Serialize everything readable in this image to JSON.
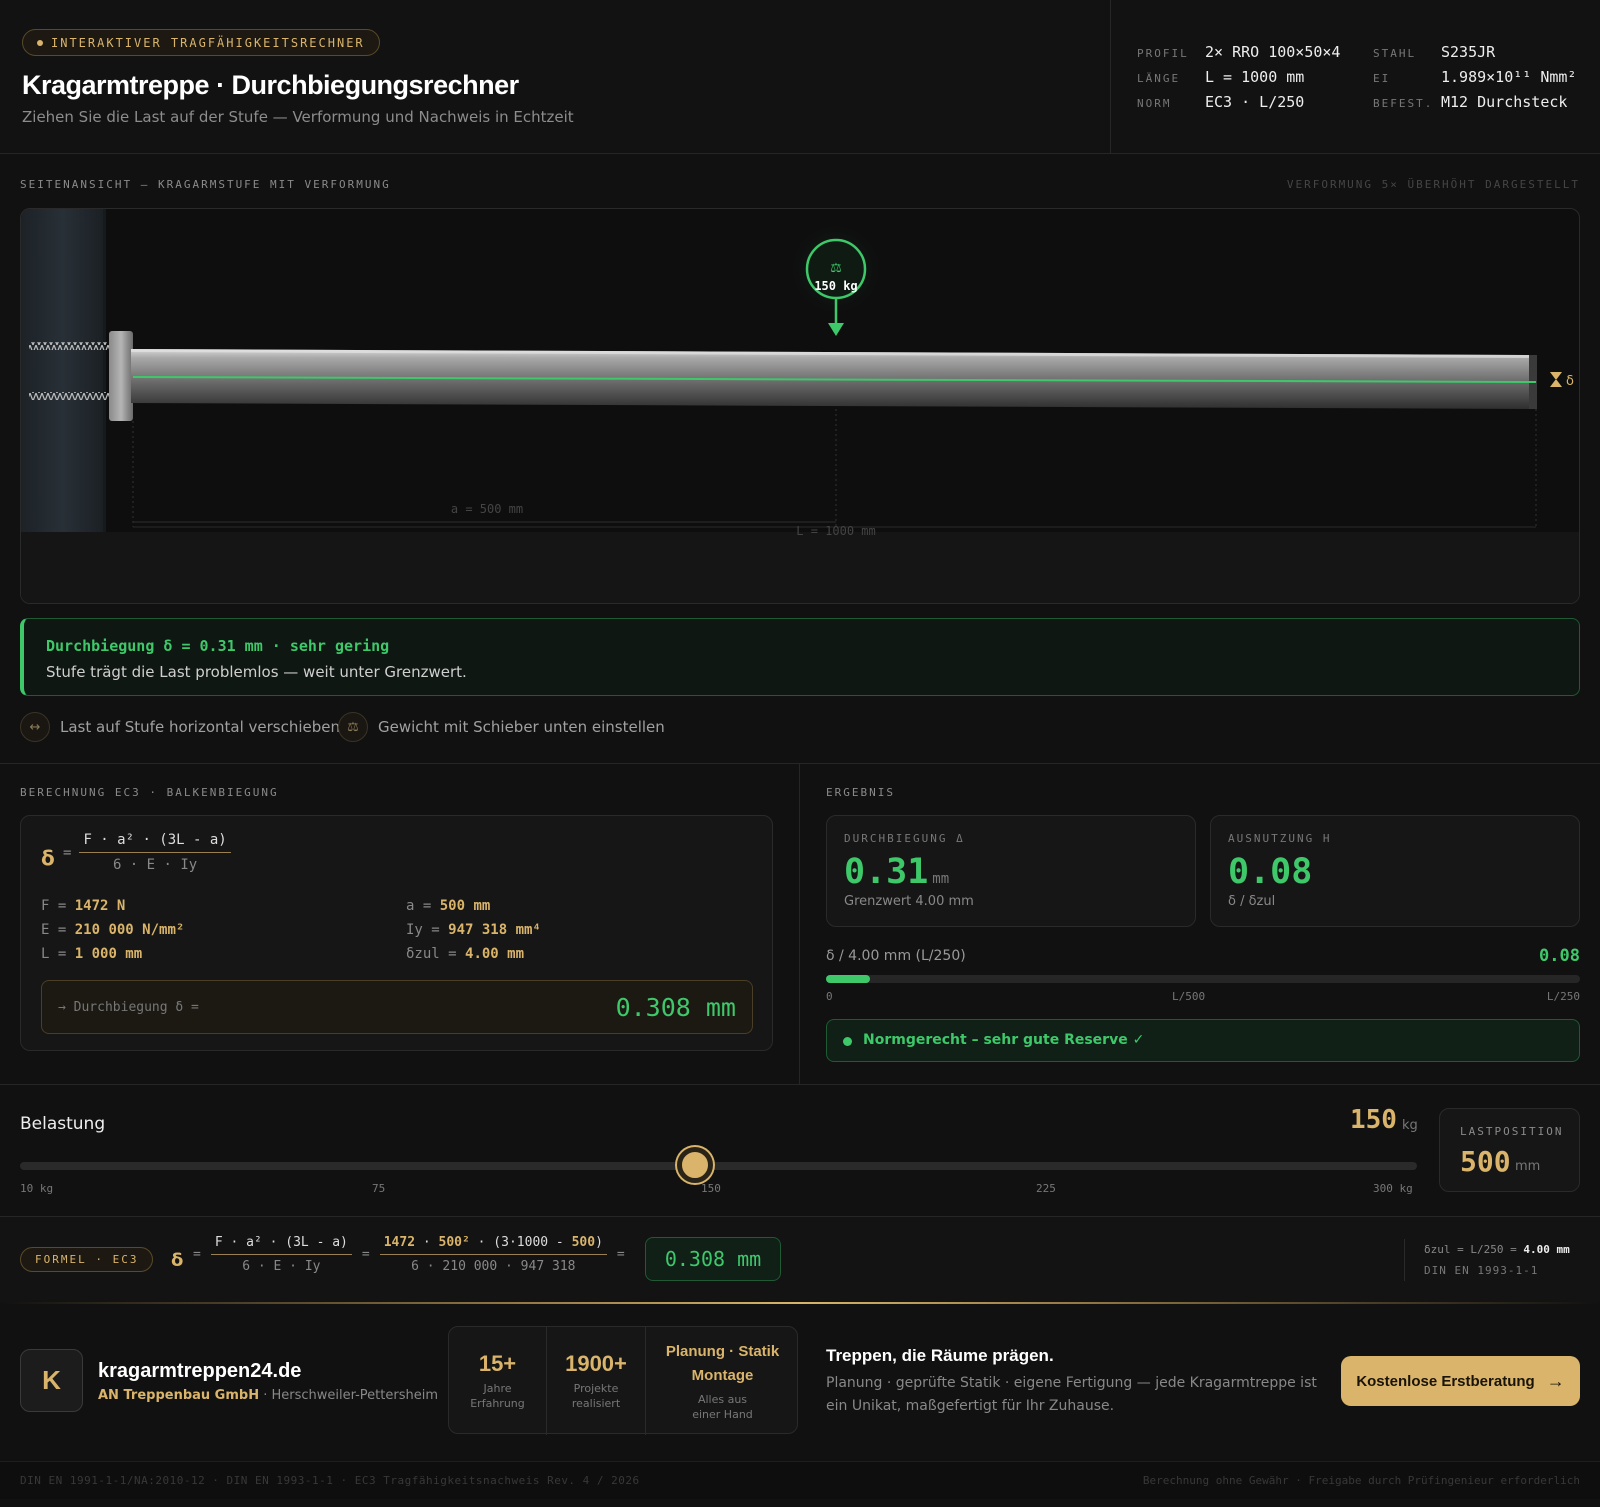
{
  "header": {
    "badge": "INTERAKTIVER TRAGFÄHIGKEITSRECHNER",
    "title": "Kragarmtreppe · Durchbiegungsrechner",
    "subtitle": "Ziehen Sie die Last auf der Stufe — Verformung und Nachweis in Echtzeit",
    "specs": {
      "profil_label": "PROFIL",
      "profil_value": "2× RRO 100×50×4",
      "laenge_label": "LÄNGE",
      "laenge_value": "L = 1000 mm",
      "norm_label": "NORM",
      "norm_value": "EC3 · L/250",
      "stahl_label": "STAHL",
      "stahl_value": "S235JR",
      "ei_label": "EI",
      "ei_value": "1.989×10¹¹ Nmm²",
      "befest_label": "BEFEST.",
      "befest_value": "M12 Durchsteck"
    }
  },
  "side_view": {
    "label": "SEITENANSICHT — KRAGARMSTUFE MIT VERFORMUNG",
    "note": "VERFORMUNG 5× ÜBERHÖHT DARGESTELLT",
    "load_label": "150 kg",
    "dim_a": "a = 500 mm",
    "dim_L": "L = 1000 mm",
    "delta_marker": "δ",
    "load_position_fraction": 0.5
  },
  "status": {
    "line1": "Durchbiegung δ = 0.31 mm · sehr gering",
    "line2": "Stufe trägt die Last problemlos — weit unter Grenzwert."
  },
  "hints": {
    "move": "Last auf Stufe horizontal verschieben",
    "weight": "Gewicht mit Schieber unten einstellen"
  },
  "calc": {
    "label": "BERECHNUNG EC3 · BALKENBIEGUNG",
    "delta": "δ",
    "eq": "=",
    "numerator": "F · a² · (3L - a)",
    "denominator": "6 · E · Iy",
    "vars": {
      "F_name": "F =",
      "F_val": "1472 N",
      "E_name": "E =",
      "E_val": "210 000 N/mm²",
      "L_name": "L =",
      "L_val": "1 000 mm",
      "a_name": "a =",
      "a_val": "500 mm",
      "Iy_name": "Iy =",
      "Iy_val": "947 318 mm⁴",
      "dz_name": "δzul =",
      "dz_val": "4.00 mm"
    },
    "result_label": "→ Durchbiegung δ =",
    "result_value": "0.308 mm"
  },
  "results": {
    "label": "ERGEBNIS",
    "deflection_title": "DURCHBIEGUNG Δ",
    "deflection_value": "0.31",
    "deflection_unit": "mm",
    "deflection_sub": "Grenzwert 4.00 mm",
    "utilization_title": "AUSNUTZUNG Η",
    "utilization_value": "0.08",
    "utilization_sub": "δ / δzul",
    "bar_title": "δ / 4.00 mm (L/250)",
    "bar_value": "0.08",
    "bar_fraction": 0.08,
    "bar_ticks": [
      "0",
      "L/500",
      "L/250"
    ],
    "ok_text": "Normgerecht – sehr gute Reserve ✓"
  },
  "load": {
    "title": "Belastung",
    "value": "150",
    "unit": "kg",
    "slider_fraction": 0.483,
    "ticks": [
      "10 kg",
      "75",
      "150",
      "225",
      "300 kg"
    ],
    "position_label": "LASTPOSITION",
    "position_value": "500",
    "position_unit": "mm"
  },
  "formula": {
    "badge": "FORMEL · EC3",
    "delta": "δ",
    "eq": "=",
    "num": "F · a² · (3L - a)",
    "den": "6 · E · Iy",
    "num2_a": "1472",
    "num2_b": "· ",
    "num2_c": "500²",
    "num2_d": " · (3·1000 - ",
    "num2_e": "500",
    "num2_f": ")",
    "den2": "6 · 210 000 · 947 318",
    "result": "0.308 mm",
    "side1_a": "δzul = L/250 = ",
    "side1_b": "4.00 mm",
    "side2": "DIN EN 1993-1-1"
  },
  "footer": {
    "logo_letter": "K",
    "site": "kragarmtreppen24.de",
    "company": "AN Treppenbau GmbH",
    "location": " · Herschweiler-Pettersheim",
    "stat1_n": "15+",
    "stat1_d1": "Jahre",
    "stat1_d2": "Erfahrung",
    "stat2_n": "1900+",
    "stat2_d1": "Projekte",
    "stat2_d2": "realisiert",
    "stat3_n1": "Planung · Statik",
    "stat3_n2": "Montage",
    "stat3_d1": "Alles aus",
    "stat3_d2": "einer Hand",
    "tag_title": "Treppen, die Räume prägen.",
    "tag_text": "Planung · geprüfte Statik · eigene Fertigung — jede Kragarmtreppe ist ein Unikat, maßgefertigt für Ihr Zuhause.",
    "cta": "Kostenlose Erstberatung",
    "bottom_left": "DIN EN 1991-1-1/NA:2010-12 · DIN EN 1993-1-1 · EC3 Tragfähigkeitsnachweis Rev. 4 / 2026",
    "bottom_right": "Berechnung ohne Gewähr · Freigabe durch Prüfingenieur erforderlich"
  },
  "colors": {
    "accent_gold": "#d9b46a",
    "accent_green": "#3ec86a",
    "background": "#111111"
  }
}
